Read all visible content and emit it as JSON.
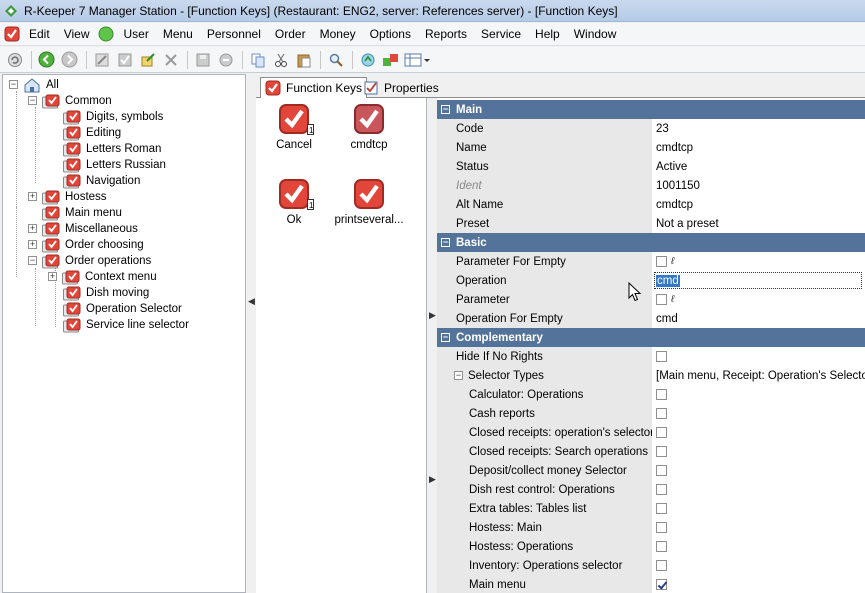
{
  "window": {
    "title": "R-Keeper 7 Manager Station - [Function Keys] (Restaurant: ENG2, server: References server) - [Function Keys]"
  },
  "menu": [
    "Edit",
    "View",
    "User",
    "Menu",
    "Personnel",
    "Order",
    "Money",
    "Options",
    "Reports",
    "Service",
    "Help",
    "Window"
  ],
  "toolbar_icons": [
    "refresh-icon",
    "back-icon",
    "forward-icon",
    "edit-icon",
    "check-icon",
    "export-icon",
    "delete-icon",
    "save-icon",
    "cancel-icon",
    "copy-icon",
    "cut-icon",
    "paste-icon",
    "find-icon",
    "refresh-data-icon",
    "move-icon",
    "view-icon"
  ],
  "tree": {
    "root": "All",
    "items": [
      {
        "label": "Common",
        "level": 1,
        "expanded": true
      },
      {
        "label": "Digits, symbols",
        "level": 2
      },
      {
        "label": "Editing",
        "level": 2
      },
      {
        "label": "Letters Roman",
        "level": 2
      },
      {
        "label": "Letters Russian",
        "level": 2
      },
      {
        "label": "Navigation",
        "level": 2
      },
      {
        "label": "Hostess",
        "level": 1,
        "expanded": false
      },
      {
        "label": "Main menu",
        "level": 1
      },
      {
        "label": "Miscellaneous",
        "level": 1,
        "expanded": false
      },
      {
        "label": "Order choosing",
        "level": 1,
        "expanded": false
      },
      {
        "label": "Order operations",
        "level": 1,
        "expanded": true
      },
      {
        "label": "Context menu",
        "level": 2,
        "expanded": false
      },
      {
        "label": "Dish moving",
        "level": 2
      },
      {
        "label": "Operation Selector",
        "level": 2
      },
      {
        "label": "Service line selector",
        "level": 2
      }
    ]
  },
  "tabs": [
    "Function Keys",
    "Properties"
  ],
  "function_keys": [
    {
      "label": "Cancel",
      "selected": false
    },
    {
      "label": "cmdtcp",
      "selected": true
    },
    {
      "label": "Ok",
      "selected": false
    },
    {
      "label": "printseveral..."
    }
  ],
  "properties": {
    "main": {
      "title": "Main",
      "rows": [
        {
          "name": "Code",
          "value": "23"
        },
        {
          "name": "Name",
          "value": "cmdtcp"
        },
        {
          "name": "Status",
          "value": "Active"
        },
        {
          "name": "Ident",
          "value": "1001150"
        },
        {
          "name": "Alt Name",
          "value": "cmdtcp"
        },
        {
          "name": "Preset",
          "value": "Not a preset"
        }
      ]
    },
    "basic": {
      "title": "Basic",
      "rows": [
        {
          "name": "Parameter For Empty",
          "value": ""
        },
        {
          "name": "Operation",
          "value": "cmd"
        },
        {
          "name": "Parameter",
          "value": ""
        },
        {
          "name": "Operation For Empty",
          "value": "cmd"
        }
      ]
    },
    "complementary": {
      "title": "Complementary",
      "hide_if_no_rights": "Hide If No Rights",
      "selector_types": {
        "name": "Selector Types",
        "value": "[Main menu, Receipt: Operation's Selector]"
      },
      "subs": [
        {
          "name": "Calculator: Operations",
          "checked": false
        },
        {
          "name": "Cash reports",
          "checked": false
        },
        {
          "name": "Closed receipts: operation's selector",
          "checked": false
        },
        {
          "name": "Closed receipts: Search operations",
          "checked": false
        },
        {
          "name": "Deposit/collect money Selector",
          "checked": false
        },
        {
          "name": "Dish rest control: Operations",
          "checked": false
        },
        {
          "name": "Extra tables: Tables list",
          "checked": false
        },
        {
          "name": "Hostess: Main",
          "checked": false
        },
        {
          "name": "Hostess: Operations",
          "checked": false
        },
        {
          "name": "Inventory: Operations selector",
          "checked": false
        },
        {
          "name": "Main menu",
          "checked": true
        }
      ]
    }
  },
  "colors": {
    "category": "#54739b",
    "accent_red": "#e2463a"
  }
}
